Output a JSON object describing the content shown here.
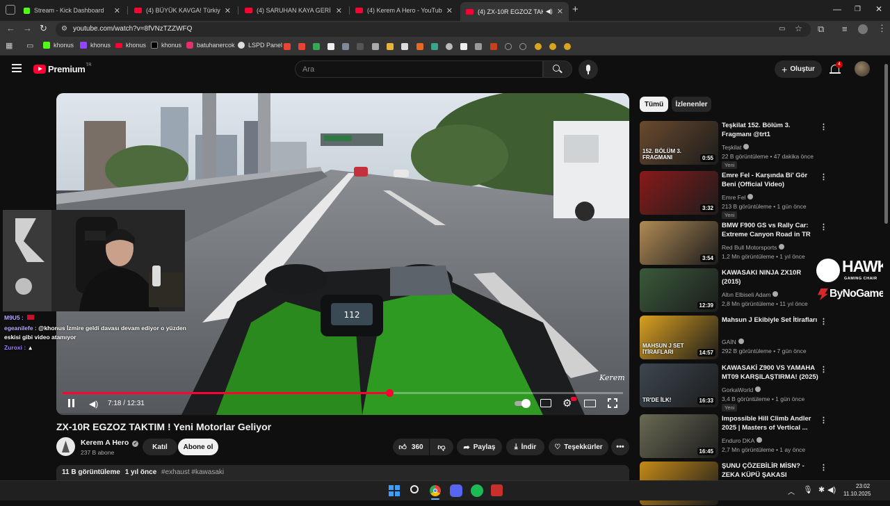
{
  "browser": {
    "tabs": [
      {
        "title": "Stream - Kick Dashboard",
        "favicon": "kick-icon"
      },
      {
        "title": "(4) BÜYÜK KAVGA! Türkiye'de Y",
        "favicon": "youtube-icon"
      },
      {
        "title": "(4) SARUHAN KAYA GERİ DÖNÜ",
        "favicon": "youtube-icon"
      },
      {
        "title": "(4) Kerem A Hero - YouTube",
        "favicon": "youtube-icon"
      },
      {
        "title": "(4) ZX-10R EGZOZ TAKTIM",
        "favicon": "youtube-icon"
      }
    ],
    "url": "youtube.com/watch?v=8fVNzTZZWFQ",
    "bookmarks": [
      "khonus",
      "khonus",
      "khonus",
      "khonus",
      "batuhanercok",
      "LSPD Panel"
    ]
  },
  "youtube": {
    "logo_text": "Premium",
    "region": "TR",
    "search_placeholder": "Ara",
    "create_label": "Oluştur",
    "notification_count": "4"
  },
  "player": {
    "time": "7:18 / 12:31",
    "progress": 0.583,
    "watermark": "Kerem"
  },
  "chat": [
    {
      "user": "M9U5 :",
      "text": "",
      "color": "#b8a9ff"
    },
    {
      "user": "egeanilefe :",
      "text": "@khonus İzmire geldi davası devam ediyor o yüzden",
      "color": "#b8a9ff"
    },
    {
      "user": "",
      "text": "eskisi gibi video atamıyor",
      "color": "#ffffff"
    },
    {
      "user": "Zuroxi :",
      "text": "",
      "color": "#9b7bff"
    }
  ],
  "video": {
    "title": "ZX-10R EGZOZ TAKTIM ! Yeni Motorlar Geliyor",
    "channel": "Kerem A Hero",
    "subscribers": "237 B abone",
    "join_label": "Katıl",
    "subscribe_label": "Abone ol",
    "likes": "360",
    "share_label": "Paylaş",
    "download_label": "İndir",
    "thanks_label": "Teşekkürler",
    "views": "11 B görüntüleme",
    "age": "1 yıl önce",
    "tags": "#exhaust #kawasaki"
  },
  "chips": [
    "Tümü",
    "İzlenenler"
  ],
  "recommendations": [
    {
      "title": "Teşkilat 152. Bölüm 3. Fragmanı @trt1",
      "channel": "Teşkilat",
      "stats": "22 B görüntüleme • 47 dakika önce",
      "badge": "Yeni",
      "duration": "0:55",
      "thumb_text": "152. BÖLÜM 3. FRAGMANI",
      "thumb_color": "#6a4a2e"
    },
    {
      "title": "Emre Fel - Karşında Bi' Gör Beni (Official Video)",
      "channel": "Emre Fel",
      "stats": "213 B görüntüleme • 1 gün önce",
      "badge": "Yeni",
      "duration": "3:32",
      "thumb_text": "",
      "thumb_color": "#8a1a1a"
    },
    {
      "title": "BMW F900 GS vs Rally Car: Extreme Canyon Road in TR",
      "channel": "Red Bull Motorsports",
      "stats": "1,2 Mn görüntüleme • 1 yıl önce",
      "badge": "",
      "duration": "3:54",
      "thumb_text": "",
      "thumb_color": "#b08a55"
    },
    {
      "title": "KAWASAKI NINJA ZX10R (2015)",
      "channel": "Altın Elbiseli Adam",
      "stats": "2,8 Mn görüntüleme • 11 yıl önce",
      "badge": "",
      "duration": "12:39",
      "thumb_text": "",
      "thumb_color": "#3a5a3a"
    },
    {
      "title": "Mahsun J Ekibiyle Set İtirafları",
      "channel": "GAİN",
      "stats": "292 B görüntüleme • 7 gün önce",
      "badge": "",
      "duration": "14:57",
      "thumb_text": "MAHSUN J SET İTİRAFLARI",
      "thumb_color": "#d9a020"
    },
    {
      "title": "KAWASAKİ Z900 VS YAMAHA MT09 KARŞILAŞTIRMA! (2025)",
      "channel": "GorkaWorld",
      "stats": "3,4 B görüntüleme • 1 gün önce",
      "badge": "Yeni",
      "duration": "16:33",
      "thumb_text": "TR'DE İLK!",
      "thumb_color": "#3d4750"
    },
    {
      "title": "Impossible Hill Climb Andler 2025 | Masters of Vertical ...",
      "channel": "Enduro DKA",
      "stats": "2,7 Mn görüntüleme • 1 ay önce",
      "badge": "",
      "duration": "16:45",
      "thumb_text": "",
      "thumb_color": "#6a6a55"
    },
    {
      "title": "ŞUNU ÇÖZEBİLİR MİSN? - ZEKA KÜPÜ ŞAKASI",
      "channel": "",
      "stats": "",
      "badge": "",
      "duration": "",
      "thumb_text": "NASIL OLDU BU?",
      "thumb_color": "#c48a18"
    }
  ],
  "overlay": {
    "hawk": "HAWK",
    "hawk_sub": "GAMING CHAIR",
    "bynogame": "ByNoGame"
  },
  "taskbar": {
    "time": "23:02",
    "date": "11.10.2025"
  },
  "colors": {
    "accent": "#ff0033",
    "kick": "#53fc18"
  }
}
